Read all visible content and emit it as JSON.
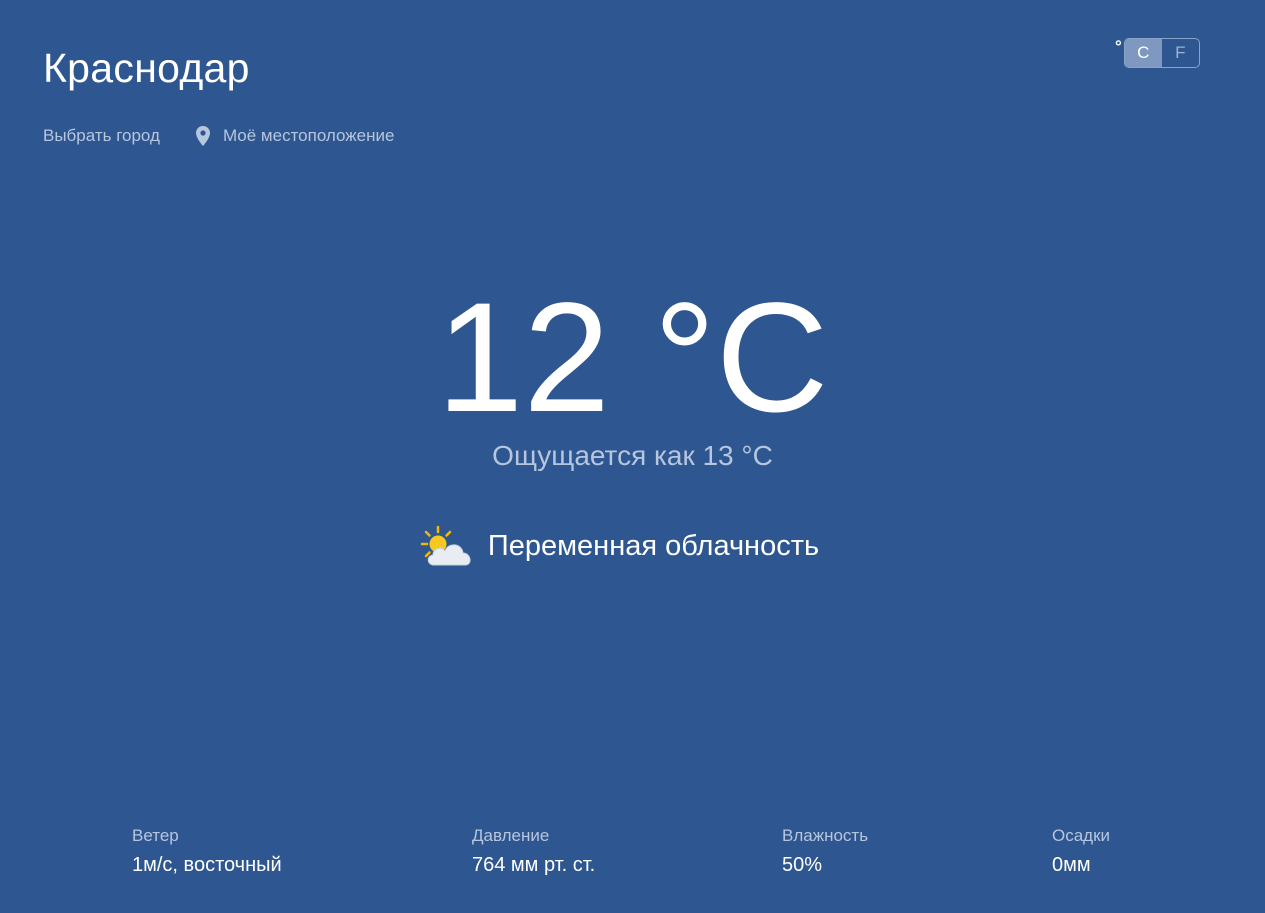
{
  "city": "Краснодар",
  "choose_city": "Выбрать город",
  "my_location": "Моё местоположение",
  "units": {
    "degree_symbol": "°",
    "celsius": "C",
    "fahrenheit": "F",
    "selected": "C"
  },
  "temperature": "12 °C",
  "feels_like": "Ощущается как 13 °C",
  "condition": {
    "icon": "partly-cloudy-icon",
    "text": "Переменная облачность"
  },
  "stats": {
    "wind": {
      "label": "Ветер",
      "value": "1м/с, восточный"
    },
    "pressure": {
      "label": "Давление",
      "value": "764 мм рт. ст."
    },
    "humidity": {
      "label": "Влажность",
      "value": "50%"
    },
    "precipitation": {
      "label": "Осадки",
      "value": "0мм"
    }
  },
  "colors": {
    "background": "#2e5690",
    "muted_text": "#b6c6de",
    "toggle_active": "#7f98bf"
  }
}
